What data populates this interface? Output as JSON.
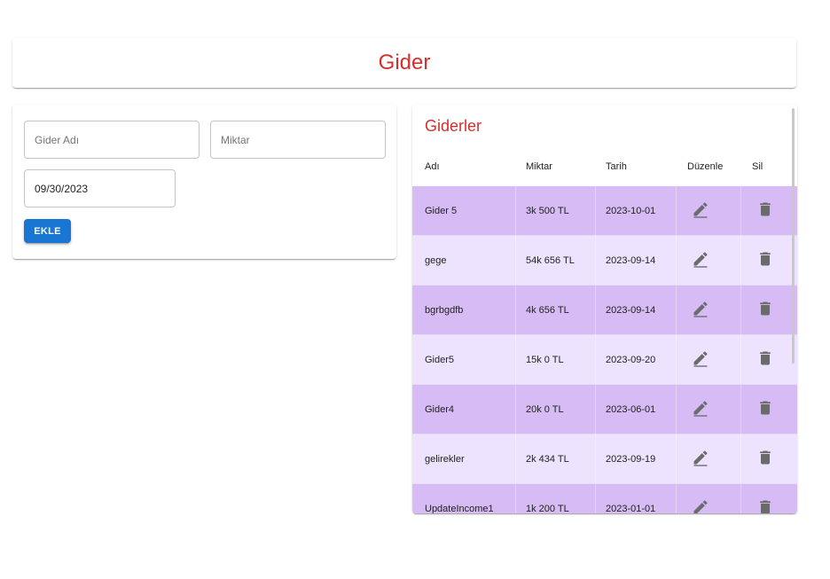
{
  "header": {
    "title": "Gider"
  },
  "form": {
    "name_placeholder": "Gider Adı",
    "amount_placeholder": "Miktar",
    "date_value": "09/30/2023",
    "add_label": "EKLE"
  },
  "list": {
    "title": "Giderler",
    "columns": {
      "name": "Adı",
      "amount": "Miktar",
      "date": "Tarih",
      "edit": "Düzenle",
      "delete": "Sil"
    },
    "rows": [
      {
        "name": "Gider 5",
        "amount": "3k 500 TL",
        "date": "2023-10-01"
      },
      {
        "name": "gege",
        "amount": "54k 656 TL",
        "date": "2023-09-14"
      },
      {
        "name": "bgrbgdfb",
        "amount": "4k 656 TL",
        "date": "2023-09-14"
      },
      {
        "name": "Gider5",
        "amount": "15k 0 TL",
        "date": "2023-09-20"
      },
      {
        "name": "Gider4",
        "amount": "20k 0 TL",
        "date": "2023-06-01"
      },
      {
        "name": "gelirekler",
        "amount": "2k 434 TL",
        "date": "2023-09-19"
      },
      {
        "name": "UpdateIncome1",
        "amount": "1k 200 TL",
        "date": "2023-01-01"
      }
    ],
    "edit_icon": "pencil-edit-icon",
    "delete_icon": "trash-delete-icon"
  },
  "colors": {
    "accent": "#d32f2f",
    "button": "#1976d2",
    "row_dark": "#d6bbf4",
    "row_light": "#ede3fe",
    "icon": "#6b6b6b"
  }
}
